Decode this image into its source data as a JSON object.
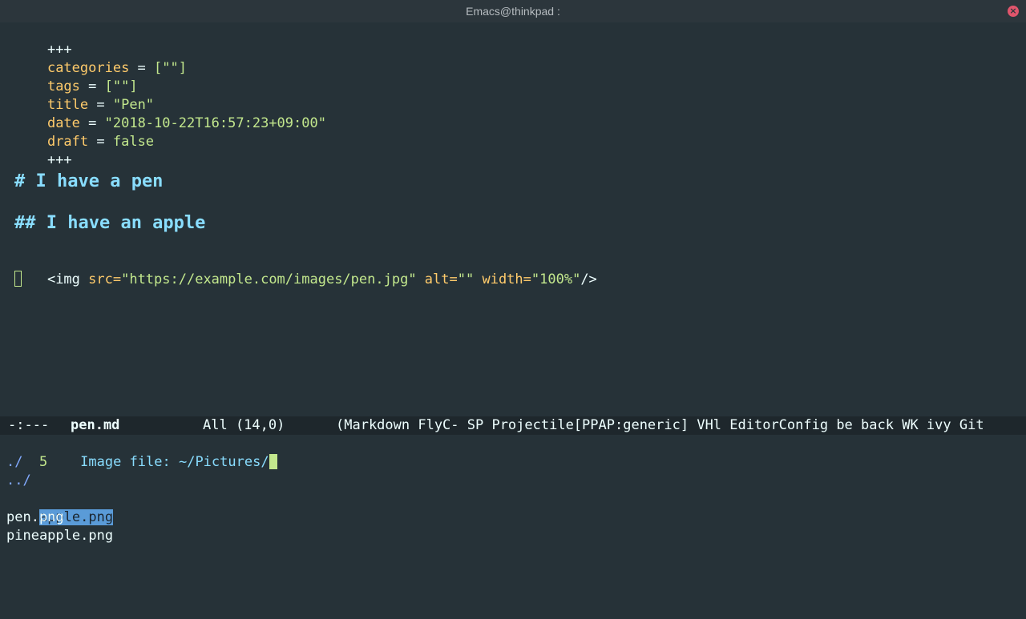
{
  "window": {
    "title": "Emacs@thinkpad :",
    "close_icon": "close-icon"
  },
  "editor": {
    "lines": {
      "fence_open": "+++",
      "categories_key": "categories",
      "categories_eq": " = ",
      "categories_val": "[\"\"]",
      "tags_key": "tags",
      "tags_eq": " = ",
      "tags_val": "[\"\"]",
      "title_key": "title",
      "title_eq": " = ",
      "title_val": "\"Pen\"",
      "date_key": "date",
      "date_eq": " = ",
      "date_val": "\"2018-10-22T16:57:23+09:00\"",
      "draft_key": "draft",
      "draft_eq": " = ",
      "draft_val": "false",
      "fence_close": "+++",
      "h1": "# I have a pen",
      "h2": "## I have an apple",
      "img_open": "<img",
      "img_src_attr": " src=",
      "img_src_val": "\"https://example.com/images/pen.jpg\"",
      "img_alt_attr": " alt=",
      "img_alt_val": "\"\"",
      "img_width_attr": " width=",
      "img_width_val": "\"100%\"",
      "img_close": "/>"
    }
  },
  "modeline": {
    "state": "-:---",
    "buffer": "pen.md",
    "position": "All (14,0)",
    "modes": "(Markdown FlyC- SP Projectile[PPAP:generic] VHl EditorConfig be back WK ivy Git"
  },
  "minibuffer": {
    "count": "5",
    "prompt": "Image file: ~/Pictures/",
    "candidates": [
      "./",
      "../",
      "apple.png",
      "pen.png",
      "pineapple.png"
    ],
    "selected": "apple.png"
  },
  "colors": {
    "background": "#263238",
    "keyword": "#ffcb6b",
    "string": "#c3e88d",
    "heading": "#89ddff",
    "selection": "#5a9bd8"
  }
}
